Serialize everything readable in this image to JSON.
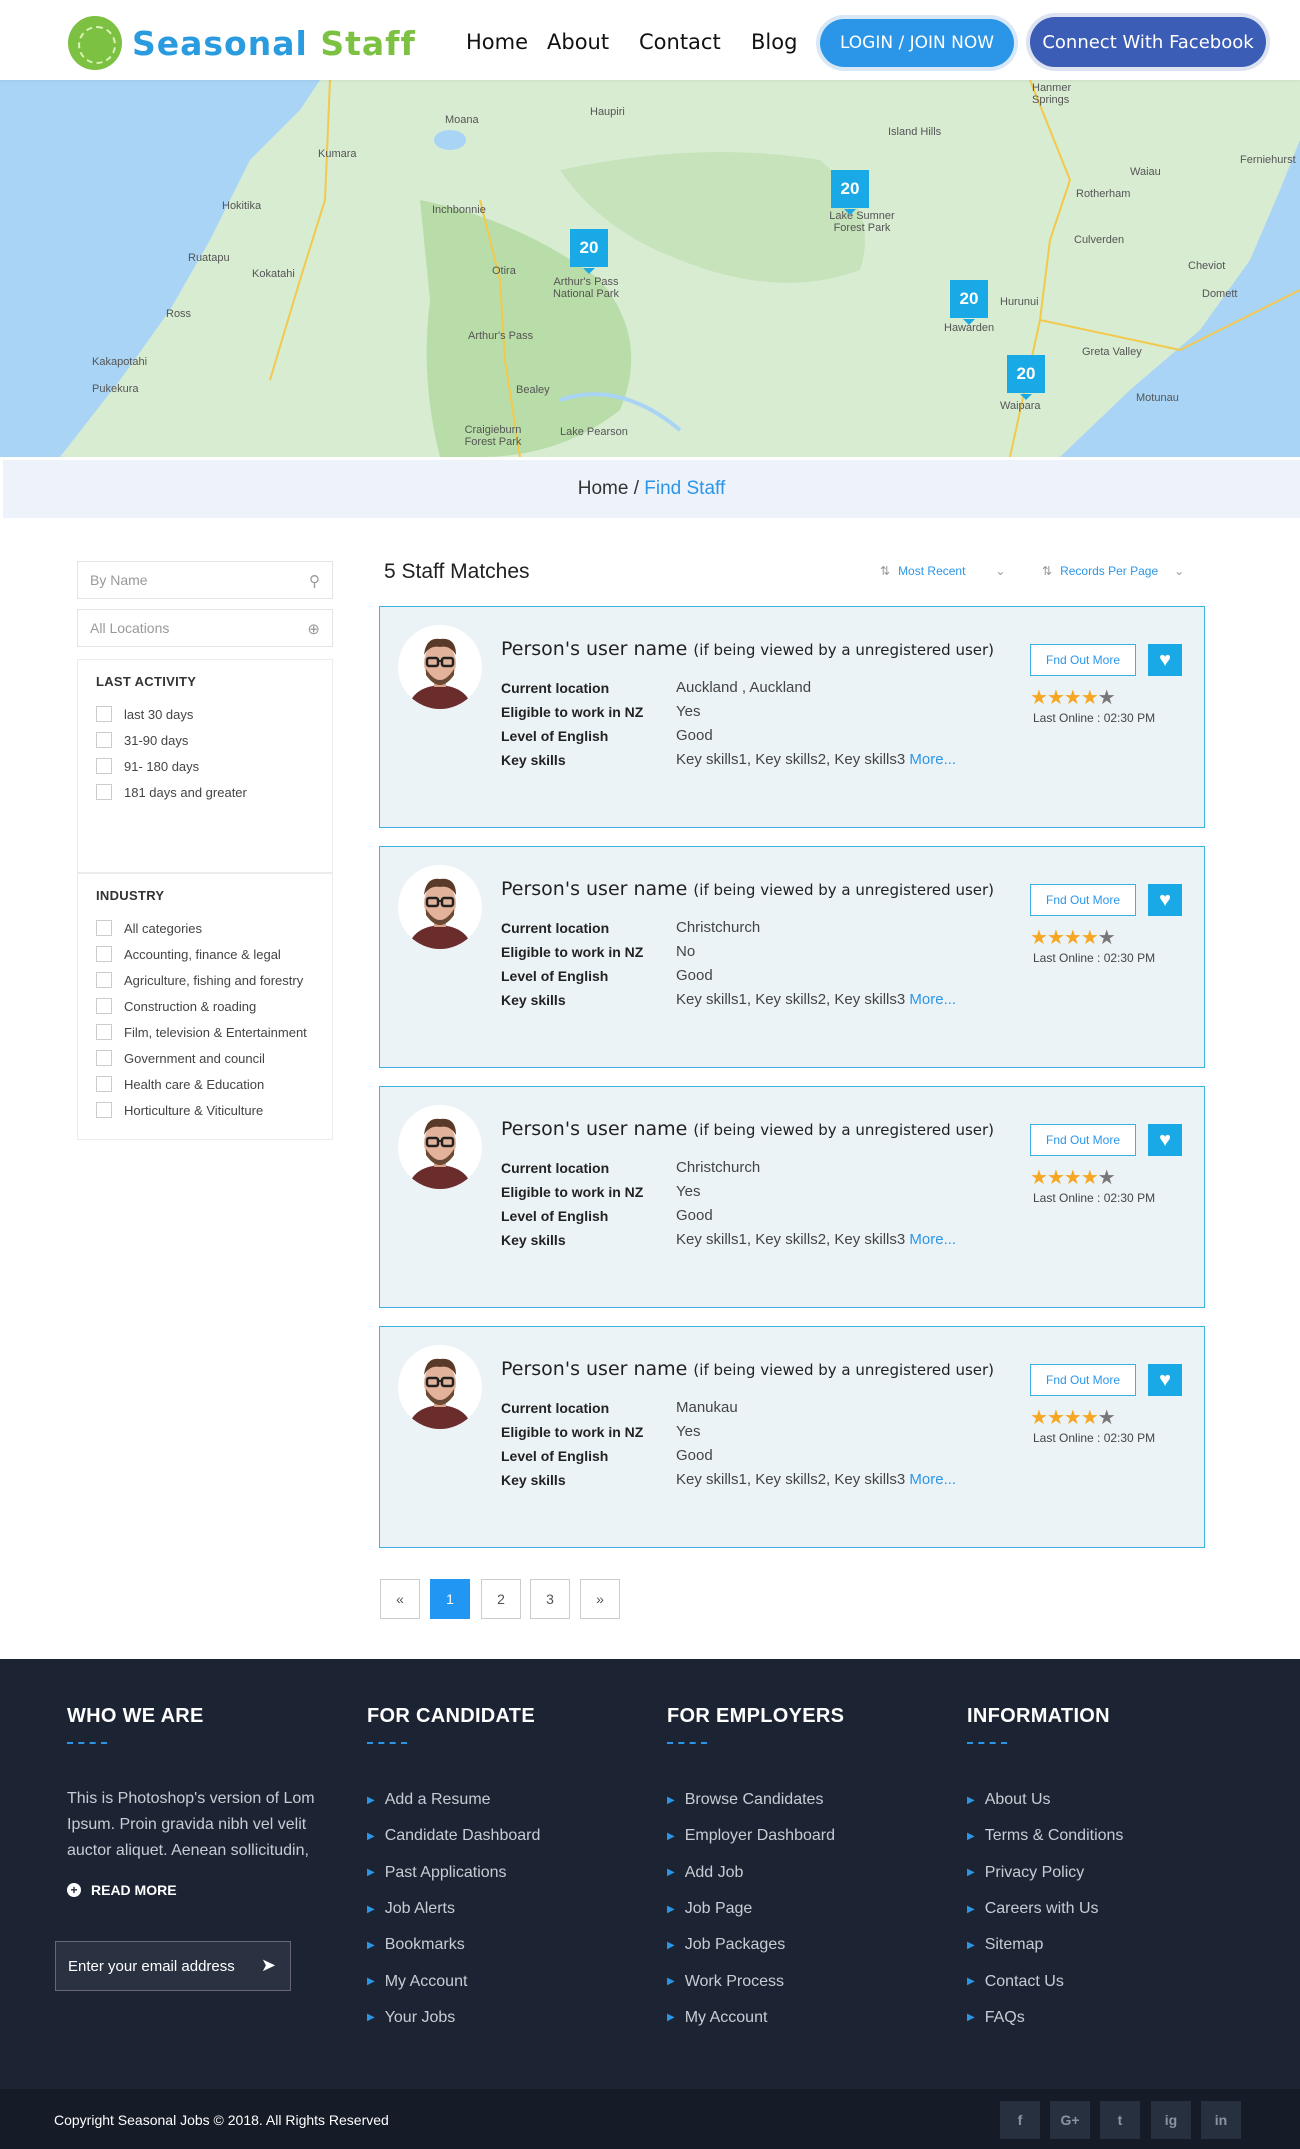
{
  "header": {
    "logo_part1": "Seasonal",
    "logo_part2": "Staff",
    "nav": [
      "Home",
      "About",
      "Contact",
      "Blog"
    ],
    "login_label": "LOGIN / JOIN NOW",
    "facebook_label": "Connect With Facebook"
  },
  "map": {
    "clusters": [
      "20",
      "20",
      "20",
      "20"
    ],
    "labels": [
      "Moana",
      "Haupiri",
      "Kumara",
      "Hokitika",
      "Inchbonnie",
      "Otira",
      "Arthur's Pass National Park",
      "Arthur's Pass",
      "Ruatapu",
      "Kokatahi",
      "Ross",
      "Kakapotahi",
      "Pukekura",
      "Bealey",
      "Craigieburn Forest Park",
      "Lake Pearson",
      "Island Hills",
      "Lake Sumner Forest Park",
      "Hanmer Springs",
      "Rotherham",
      "Waiau",
      "Ferniehurst",
      "Culverden",
      "Cheviot",
      "Domett",
      "Hurunui",
      "Hawarden",
      "Greta Valley",
      "Waipara",
      "Motunau"
    ]
  },
  "breadcrumb": {
    "home": "Home",
    "separator": " / ",
    "current": "Find Staff"
  },
  "sidebar": {
    "name_placeholder": "By Name",
    "location_placeholder": "All Locations",
    "activity_title": "LAST ACTIVITY",
    "activity": [
      "last 30 days",
      "31-90 days",
      "91- 180 days",
      "181 days and greater"
    ],
    "industry_title": "INDUSTRY",
    "industry": [
      "All categories",
      "Accounting, finance & legal",
      "Agriculture, fishing and forestry",
      "Construction & roading",
      "Film, television & Entertainment",
      "Government and council",
      "Health care & Education",
      "Horticulture & Viticulture"
    ]
  },
  "results": {
    "title": "5 Staff Matches",
    "sort_label": "Most Recent",
    "per_page_label": "Records Per Page",
    "field_labels": [
      "Current location",
      "Eligible to work in NZ",
      "Level of English",
      "Key skills"
    ],
    "cards": [
      {
        "name": "Person's user name",
        "note": "(if being viewed by a unregistered user)",
        "location": "Auckland , Auckland",
        "eligible": "Yes",
        "english": "Good",
        "skills": "Key skills1, Key skills2, Key skills3",
        "more": "More...",
        "button": "Fnd Out More",
        "rating": 4,
        "last_online": "Last Online  : 02:30 PM"
      },
      {
        "name": "Person's user name",
        "note": "(if being viewed by a unregistered user)",
        "location": "Christchurch",
        "eligible": "No",
        "english": "Good",
        "skills": "Key skills1, Key skills2, Key skills3",
        "more": "More...",
        "button": "Fnd Out More",
        "rating": 4,
        "last_online": "Last Online  : 02:30 PM"
      },
      {
        "name": "Person's user name",
        "note": "(if being viewed by a unregistered user)",
        "location": "Christchurch",
        "eligible": "Yes",
        "english": "Good",
        "skills": "Key skills1, Key skills2, Key skills3",
        "more": "More...",
        "button": "Fnd Out More",
        "rating": 4,
        "last_online": "Last Online  : 02:30 PM"
      },
      {
        "name": "Person's user name",
        "note": "(if being viewed by a unregistered user)",
        "location": "Manukau",
        "eligible": "Yes",
        "english": "Good",
        "skills": "Key skills1, Key skills2, Key skills3",
        "more": "More...",
        "button": "Fnd Out More",
        "rating": 4,
        "last_online": "Last Online  : 02:30 PM"
      }
    ]
  },
  "pagination": {
    "prev": "«",
    "pages": [
      "1",
      "2",
      "3"
    ],
    "next": "»",
    "current": "1"
  },
  "footer": {
    "who": {
      "title": "WHO WE ARE",
      "text": "This is Photoshop's version of Lom Ipsum. Proin gravida nibh vel velit auctor aliquet. Aenean sollicitudin,",
      "read_more": "READ MORE",
      "email_placeholder": "Enter your email address"
    },
    "candidate": {
      "title": "FOR CANDIDATE",
      "links": [
        "Add a Resume",
        "Candidate Dashboard",
        "Past Applications",
        "Job Alerts",
        "Bookmarks",
        "My Account",
        "Your Jobs"
      ]
    },
    "employers": {
      "title": "FOR EMPLOYERS",
      "links": [
        "Browse Candidates",
        "Employer Dashboard",
        "Add Job",
        "Job Page",
        "Job Packages",
        "Work Process",
        "My Account"
      ]
    },
    "info": {
      "title": "INFORMATION",
      "links": [
        "About Us",
        "Terms & Conditions",
        "Privacy Policy",
        "Careers with Us",
        "Sitemap",
        "Contact Us",
        "FAQs"
      ]
    },
    "copyright": "Copyright Seasonal Jobs © 2018. All Rights Reserved",
    "social": [
      "f",
      "G+",
      "t",
      "ig",
      "in"
    ]
  },
  "colors": {
    "accent": "#2b96e8",
    "brand_green": "#7cc142",
    "card_bg": "#ecf3f7",
    "footer_bg": "#1c2433"
  }
}
